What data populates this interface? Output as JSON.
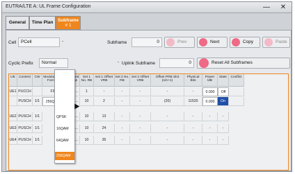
{
  "window": {
    "title": "EUTRA/LTE A: UL Frame Configuration",
    "minimize": "—",
    "close": "✕"
  },
  "tabs": [
    {
      "label": "General"
    },
    {
      "label": "Time Plan"
    },
    {
      "label": "Subframe",
      "sub": "# 1"
    }
  ],
  "controls": {
    "cell_label": "Cell",
    "cell_value": "PCell",
    "subframe_label": "Subframe",
    "subframe_value": "0",
    "prev": "Prev",
    "next": "Next",
    "copy": "Copy",
    "paste": "Paste",
    "cyclic_prefix_label": "Cyclic Prefix",
    "cyclic_prefix_value": "Normal",
    "uplink_subframe_label": "Uplink Subframe",
    "uplink_subframe_value": "0",
    "reset_all": "Reset All Subframes"
  },
  "table": {
    "headers": [
      "UE",
      "Content",
      "CW",
      "Modulation / Format",
      "Enhanced Settings",
      "Set 1 No. RB",
      "Set 1 Offset VRB",
      "Set 2 No. RB",
      "Set 2 Offset VRB",
      "Offset PRB Slot (n/n+1)",
      "Physical Bits",
      "Power /dB",
      "State",
      "Conflict"
    ],
    "rows": [
      {
        "ue": "UE1",
        "content": "PUCCH",
        "cw": "",
        "mod": "F3",
        "enh": "Config...",
        "s1rb": "1",
        "s1off": "-",
        "s2rb": "-",
        "s2off": "-",
        "offprb": "-",
        "bits": "-",
        "power": "0.000",
        "state": "Off",
        "conflict": ""
      },
      {
        "ue": "",
        "content": "PUSCH",
        "cw": "1/1",
        "mod": "256QAM",
        "enh": "Config...",
        "s1rb": "10",
        "s1off": "2",
        "s2rb": "-",
        "s2off": "-",
        "offprb": "(20)",
        "bits": "11520",
        "power": "0.000",
        "state": "On",
        "conflict": ""
      },
      {
        "ue": "UE2",
        "content": "PUSCH",
        "cw": "1/1",
        "mod": "QPSK",
        "enh": "Config...",
        "s1rb": "10",
        "s1off": "13",
        "s2rb": "-",
        "s2off": "-",
        "offprb": "-",
        "bits": "-",
        "power": "-",
        "state": "-",
        "conflict": ""
      },
      {
        "ue": "UE3",
        "content": "PUSCH",
        "cw": "1/1",
        "mod": "16QAM",
        "enh": "Config...",
        "s1rb": "10",
        "s1off": "24",
        "s2rb": "-",
        "s2off": "-",
        "offprb": "-",
        "bits": "-",
        "power": "-",
        "state": "-",
        "conflict": ""
      },
      {
        "ue": "UE4",
        "content": "PUSCH",
        "cw": "1/1",
        "mod": "64QAM",
        "enh": "Config...",
        "s1rb": "10",
        "s1off": "35",
        "s2rb": "-",
        "s2off": "-",
        "offprb": "-",
        "bits": "-",
        "power": "-",
        "state": "-",
        "conflict": ""
      }
    ]
  },
  "dropdown": {
    "options": [
      "QPSK",
      "16QAM",
      "64QAM",
      "256QAM"
    ],
    "selected": "256QAM"
  },
  "colors": {
    "accent": "#f0861c",
    "state_on": "#1f4fa8",
    "button_icon": "#ee6a86"
  }
}
